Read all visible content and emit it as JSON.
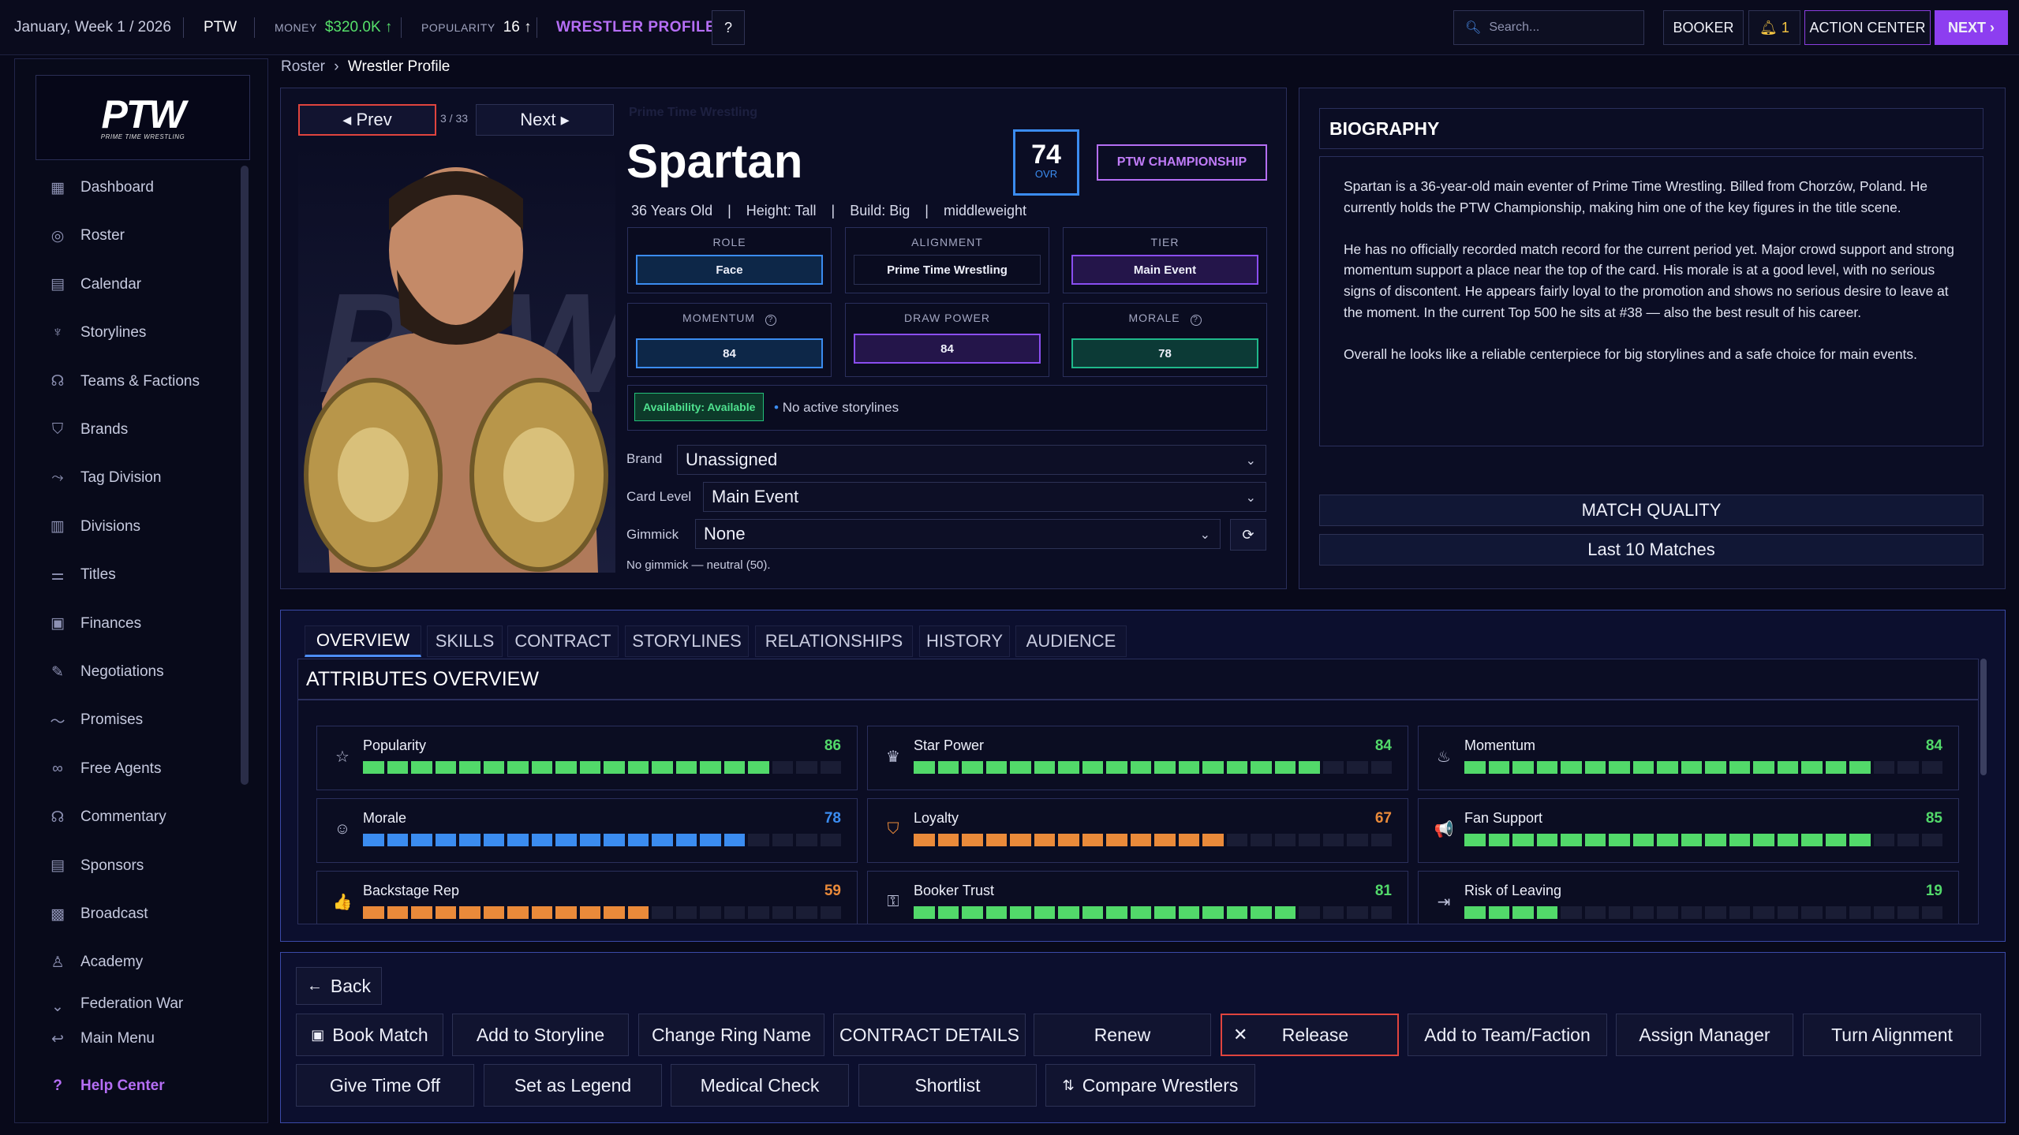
{
  "topbar": {
    "date": "January, Week 1 / 2026",
    "promotion": "PTW",
    "money_label": "MONEY",
    "money_value": "$320.0K ↑",
    "popularity_label": "POPULARITY",
    "popularity_value": "16 ↑",
    "page_name": "WRESTLER PROFILE",
    "help": "?",
    "search_placeholder": "Search...",
    "booker": "BOOKER",
    "notifications": "1",
    "action_center": "ACTION CENTER",
    "next": "NEXT ›"
  },
  "breadcrumb": {
    "root": "Roster",
    "sep": "›",
    "current": "Wrestler Profile"
  },
  "sidebar": {
    "logo": "PTW",
    "logo_sub": "PRIME TIME WRESTLING",
    "items": [
      {
        "label": "Dashboard",
        "icon": "dashboard-icon"
      },
      {
        "label": "Roster",
        "icon": "roster-icon"
      },
      {
        "label": "Calendar",
        "icon": "calendar-icon"
      },
      {
        "label": "Storylines",
        "icon": "storylines-icon"
      },
      {
        "label": "Teams & Factions",
        "icon": "teams-icon"
      },
      {
        "label": "Brands",
        "icon": "brands-icon"
      },
      {
        "label": "Tag Division",
        "icon": "tag-icon"
      },
      {
        "label": "Divisions",
        "icon": "divisions-icon"
      },
      {
        "label": "Titles",
        "icon": "titles-icon"
      },
      {
        "label": "Finances",
        "icon": "finances-icon"
      },
      {
        "label": "Negotiations",
        "icon": "negotiations-icon"
      },
      {
        "label": "Promises",
        "icon": "promises-icon"
      },
      {
        "label": "Free Agents",
        "icon": "free-agents-icon"
      },
      {
        "label": "Commentary",
        "icon": "commentary-icon"
      },
      {
        "label": "Sponsors",
        "icon": "sponsors-icon"
      },
      {
        "label": "Broadcast",
        "icon": "broadcast-icon"
      },
      {
        "label": "Academy",
        "icon": "academy-icon"
      },
      {
        "label": "Federation War",
        "icon": "federation-icon"
      }
    ],
    "main_menu": "Main Menu",
    "help_center": "Help Center"
  },
  "profile": {
    "prev": "◂ Prev",
    "index": "3 / 33",
    "next": "Next ▸",
    "promotion_ghost": "Prime Time Wrestling",
    "name": "Spartan",
    "ovr_value": "74",
    "ovr_label": "OVR",
    "title_badge": "PTW CHAMPIONSHIP",
    "info": {
      "age": "36 Years Old",
      "height": "Height: Tall",
      "build": "Build: Big",
      "weight": "middleweight",
      "sep": "|"
    },
    "role_label": "ROLE",
    "role": "Face",
    "alignment_label": "ALIGNMENT",
    "alignment": "Prime Time Wrestling",
    "tier_label": "TIER",
    "tier": "Main Event",
    "momentum_label": "MOMENTUM",
    "momentum": "84",
    "draw_label": "DRAW POWER",
    "draw": "84",
    "morale_label": "MORALE",
    "morale": "78",
    "availability": "Availability: Available",
    "storylines_status": "No active storylines",
    "brand_label": "Brand",
    "brand": "Unassigned",
    "card_label": "Card Level",
    "card": "Main Event",
    "gimmick_label": "Gimmick",
    "gimmick": "None",
    "gimmick_note": "No gimmick — neutral (50)."
  },
  "biography": {
    "title": "BIOGRAPHY",
    "p1": "Spartan is a 36-year-old main eventer of Prime Time Wrestling. Billed from Chorzów, Poland. He currently holds the PTW Championship, making him one of the key figures in the title scene.",
    "p2": "He has no officially recorded match record for the current period yet. Major crowd support and strong momentum support a place near the top of the card. His morale is at a good level, with no serious signs of discontent. He appears fairly loyal to the promotion and shows no serious desire to leave at the moment. In the current Top 500 he sits at #38 — also the best result of his career.",
    "p3": "Overall he looks like a reliable centerpiece for big storylines and a safe choice for main events.",
    "match_quality": "MATCH QUALITY",
    "last_matches": "Last 10 Matches"
  },
  "tabs": [
    "OVERVIEW",
    "SKILLS",
    "CONTRACT",
    "STORYLINES",
    "RELATIONSHIPS",
    "HISTORY",
    "AUDIENCE"
  ],
  "attributes_title": "ATTRIBUTES OVERVIEW",
  "attributes": [
    {
      "name": "Popularity",
      "value": 86,
      "color": "#52d96a",
      "icon": "star-icon",
      "glyph": "☆"
    },
    {
      "name": "Star Power",
      "value": 84,
      "color": "#52d96a",
      "icon": "crown-icon",
      "glyph": "♛"
    },
    {
      "name": "Momentum",
      "value": 84,
      "color": "#52d96a",
      "icon": "flame-icon",
      "glyph": "♨"
    },
    {
      "name": "Morale",
      "value": 78,
      "color": "#3b8cf0",
      "icon": "smile-icon",
      "glyph": "☺"
    },
    {
      "name": "Loyalty",
      "value": 67,
      "color": "#ea8a3a",
      "icon": "shield-heart-icon",
      "glyph": "⛉"
    },
    {
      "name": "Fan Support",
      "value": 85,
      "color": "#52d96a",
      "icon": "megaphone-icon",
      "glyph": "📢"
    },
    {
      "name": "Backstage Rep",
      "value": 59,
      "color": "#ea8a3a",
      "icon": "thumbs-up-icon",
      "glyph": "👍"
    },
    {
      "name": "Booker Trust",
      "value": 81,
      "color": "#52d96a",
      "icon": "key-icon",
      "glyph": "⚿"
    },
    {
      "name": "Risk of Leaving",
      "value": 19,
      "color": "#52d96a",
      "icon": "exit-icon",
      "glyph": "⇥"
    }
  ],
  "actions": {
    "back": "Back",
    "book_match": "Book Match",
    "add_storyline": "Add to Storyline",
    "change_name": "Change Ring Name",
    "contract_details": "CONTRACT DETAILS",
    "renew": "Renew",
    "release": "Release",
    "add_team": "Add to Team/Faction",
    "assign_manager": "Assign Manager",
    "turn_alignment": "Turn Alignment",
    "time_off": "Give Time Off",
    "legend": "Set as Legend",
    "medical": "Medical Check",
    "shortlist": "Shortlist",
    "compare": "Compare Wrestlers"
  }
}
